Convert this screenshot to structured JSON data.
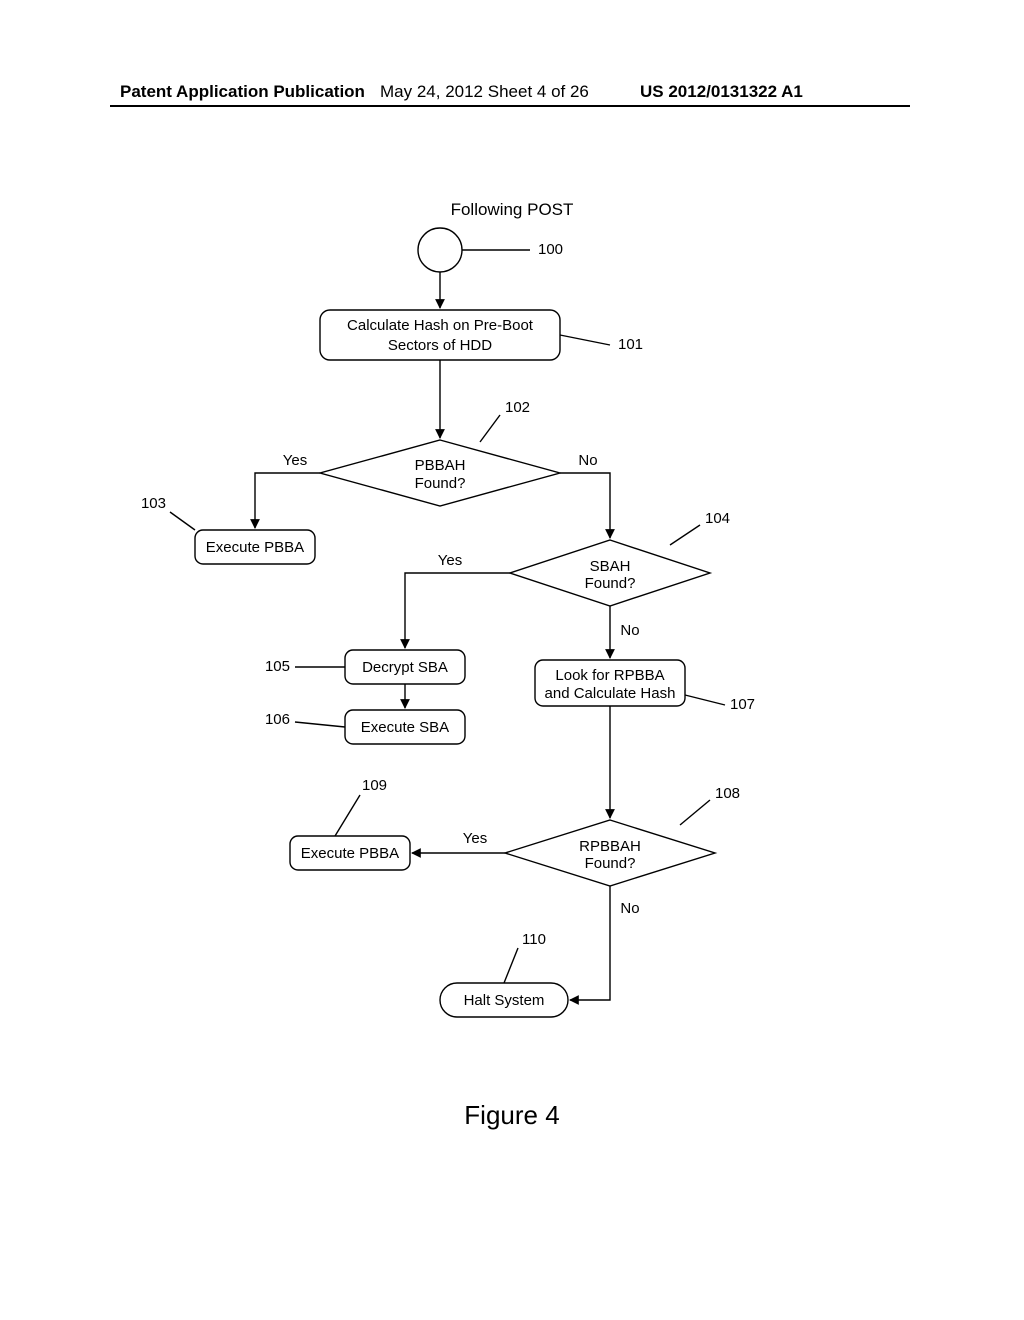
{
  "header": {
    "left": "Patent Application Publication",
    "center": "May 24, 2012  Sheet 4 of 26",
    "right": "US 2012/0131322 A1"
  },
  "diagram": {
    "title": "Following POST",
    "caption": "Figure 4",
    "nodes": {
      "n101": {
        "line1": "Calculate Hash on Pre-Boot",
        "line2": "Sectors of HDD"
      },
      "n102": {
        "line1": "PBBAH",
        "line2": "Found?"
      },
      "n103": "Execute PBBA",
      "n104": {
        "line1": "SBAH",
        "line2": "Found?"
      },
      "n105": "Decrypt SBA",
      "n106": "Execute SBA",
      "n107": {
        "line1": "Look for RPBBA",
        "line2": "and Calculate Hash"
      },
      "n108": {
        "line1": "RPBBAH",
        "line2": "Found?"
      },
      "n109": "Execute PBBA",
      "n110": "Halt System"
    },
    "labels": {
      "l100": "100",
      "l101": "101",
      "l102": "102",
      "l103": "103",
      "l104": "104",
      "l105": "105",
      "l106": "106",
      "l107": "107",
      "l108": "108",
      "l109": "109",
      "l110": "110"
    },
    "edges": {
      "yes": "Yes",
      "no": "No"
    }
  }
}
